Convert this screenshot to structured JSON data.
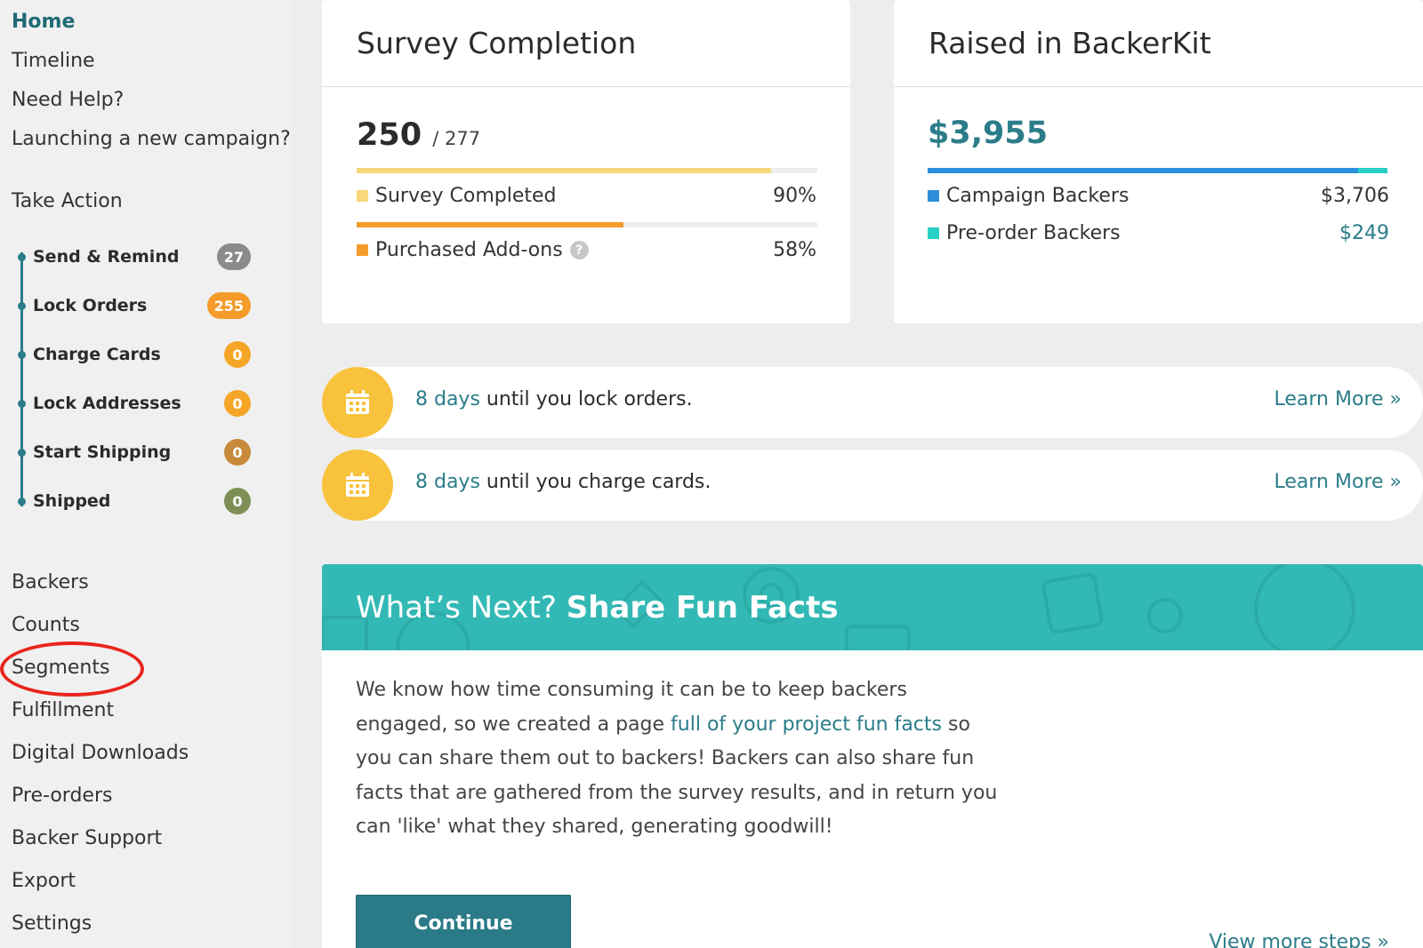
{
  "sidebar": {
    "top_links": [
      "Home",
      "Timeline",
      "Need Help?",
      "Launching a new campaign?"
    ],
    "take_action_title": "Take Action",
    "steps": [
      {
        "label": "Send & Remind",
        "count": "27",
        "color": "#8a8a8a"
      },
      {
        "label": "Lock Orders",
        "count": "255",
        "color": "#f49b2a"
      },
      {
        "label": "Charge Cards",
        "count": "0",
        "color": "#f5a627"
      },
      {
        "label": "Lock Addresses",
        "count": "0",
        "color": "#f5a627"
      },
      {
        "label": "Start Shipping",
        "count": "0",
        "color": "#c68a3a"
      },
      {
        "label": "Shipped",
        "count": "0",
        "color": "#7d8f55"
      }
    ],
    "bottom_links": [
      "Backers",
      "Counts",
      "Segments",
      "Fulfillment",
      "Digital Downloads",
      "Pre-orders",
      "Backer Support",
      "Export",
      "Settings"
    ]
  },
  "survey": {
    "title": "Survey Completion",
    "completed": "250",
    "total": "/ 277",
    "rows": [
      {
        "label": "Survey Completed",
        "value": "90%",
        "fraction": 0.9,
        "color": "#f9d87a"
      },
      {
        "label": "Purchased Add-ons",
        "value": "58%",
        "fraction": 0.58,
        "color": "#f49b2a"
      }
    ]
  },
  "raised": {
    "title": "Raised in BackerKit",
    "amount": "$3,955",
    "campaign_fraction": 0.937,
    "rows": [
      {
        "label": "Campaign Backers",
        "value": "$3,706",
        "color": "#2d8fdc"
      },
      {
        "label": "Pre-order Backers",
        "value": "$249",
        "color": "#27cfc6"
      }
    ]
  },
  "reminders": [
    {
      "days": "8 days",
      "text": " until you lock orders.",
      "link": "Learn More »"
    },
    {
      "days": "8 days",
      "text": " until you charge cards.",
      "link": "Learn More »"
    }
  ],
  "whats_next": {
    "prefix": "What’s Next? ",
    "title": "Share Fun Facts",
    "para_1": "We know how time consuming it can be to keep backers engaged, so we created a page ",
    "para_link": "full of your project fun facts",
    "para_2": " so you can share them out to backers! Backers can also share fun facts that are gathered from the survey results, and in return you can 'like' what they shared, generating goodwill!",
    "continue": "Continue",
    "more": "View more steps »"
  },
  "colors": {
    "accent": "#2a7d89",
    "teal_banner": "#33b9b5",
    "highlight": "#e8241c"
  }
}
